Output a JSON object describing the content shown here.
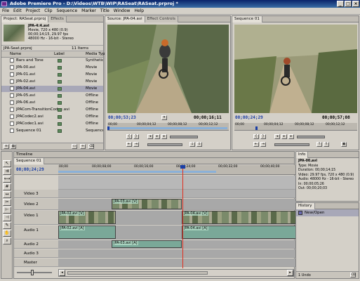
{
  "window": {
    "title": "Adobe Premiere Pro - D:\\Videos\\WTB\\WIP\\RASeat\\RASeat.prproj *"
  },
  "menu": [
    "File",
    "Edit",
    "Project",
    "Clip",
    "Sequence",
    "Marker",
    "Title",
    "Window",
    "Help"
  ],
  "project": {
    "tabs": [
      "Project: RASeat.prproj",
      "Effects"
    ],
    "preview": {
      "name": "JPA-4:4.avi",
      "line1": "Movie, 720 x 480 (0.9)",
      "line2": "00;00;14;15, 29.97 fps",
      "line3": "48000 Hz - 16-bit - Stereo"
    },
    "bin_label": "JPA-Seat.prproj",
    "count": "11 Items",
    "columns": [
      "Name",
      "Label",
      "Media Type"
    ],
    "items": [
      {
        "name": "Bars and Tone",
        "type": "Synthetic"
      },
      {
        "name": "JPA-00.avi",
        "type": "Movie"
      },
      {
        "name": "JPA-01.avi",
        "type": "Movie"
      },
      {
        "name": "JPA-02.avi",
        "type": "Movie"
      },
      {
        "name": "JPA-04.avi",
        "type": "Movie"
      },
      {
        "name": "JPA-05.avi",
        "type": "Offline"
      },
      {
        "name": "JPA-06.avi",
        "type": "Offline"
      },
      {
        "name": "JPACom-TransitionCodec.avi",
        "type": "Offline"
      },
      {
        "name": "JPACodec2.avi",
        "type": "Offline"
      },
      {
        "name": "JPACodec1.avi",
        "type": "Offline"
      },
      {
        "name": "Sequence 01",
        "type": "Sequence"
      }
    ],
    "selected_index": 4
  },
  "source": {
    "tabs": [
      "Source: JPA-04.avi",
      "Effect Controls"
    ],
    "timecode_current": "00;00;53;23",
    "timecode_duration": "00;00;16;11",
    "ticks": [
      "00;00",
      "00;00;04;12",
      "00;00;08;12",
      "00;00;12;12"
    ]
  },
  "program": {
    "tabs": [
      "Sequence 01"
    ],
    "timecode_current": "00;00;24;29",
    "timecode_duration": "00;00;57;08",
    "ticks": [
      "00;00",
      "00;00;04;12",
      "00;00;08;12",
      "00;00;12;12"
    ]
  },
  "timeline": {
    "title": "Timeline",
    "tab": "Sequence 01",
    "timecode": "00;00;24;29",
    "ruler": [
      "00;00",
      "00;00;08;00",
      "00;00;16;00",
      "00;00;24;00",
      "00;00;32;00",
      "00;00;40;00"
    ],
    "tracks": [
      {
        "name": "Video 3"
      },
      {
        "name": "Video 2"
      },
      {
        "name": "Video 1"
      },
      {
        "name": "Audio 1"
      },
      {
        "name": "Audio 2"
      },
      {
        "name": "Audio 3"
      },
      {
        "name": "Master"
      }
    ],
    "clips": {
      "v2_a": "JPA-03.avi [V]",
      "v1_a": "JPA-02.avi [V]",
      "v1_b": "JPA-04.avi [V]",
      "a1_a": "JPA-02.avi [A]",
      "a1_b": "JPA-04.avi [A]",
      "a2_a": "JPA-03.avi [A]"
    }
  },
  "info": {
    "tabs": [
      "Info"
    ],
    "name": "JPA-00.avi",
    "lines": [
      "Type: Movie",
      "Duration: 00;00;14;15",
      "Video: 29.97 fps, 720 x 480 (0.9)",
      "Audio: 48000 Hz - 16-bit - Stereo",
      "",
      "In: 00;00;05;26",
      "Out: 00;00;20;03"
    ]
  },
  "history": {
    "tabs": [
      "History"
    ],
    "items": [
      "New/Open"
    ],
    "count": "1 Undo"
  },
  "colors": {
    "accent": "#1a3ea5",
    "playhead": "#e03020",
    "selection": "#a8a8b8"
  }
}
